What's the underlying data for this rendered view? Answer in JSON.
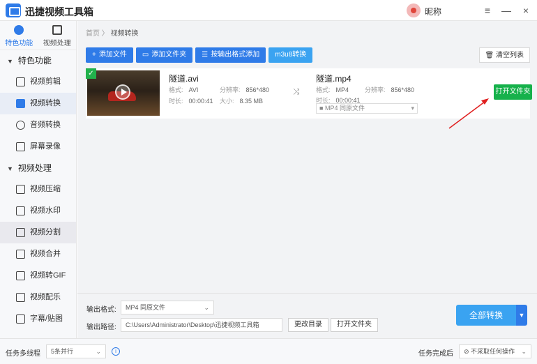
{
  "app": {
    "title": "迅捷视频工具箱",
    "user_name": "昵称"
  },
  "window": {
    "menu_icon": "≡",
    "minimize_icon": "—",
    "close_icon": "×"
  },
  "side_tabs": [
    {
      "label": "特色功能",
      "icon": "star-icon"
    },
    {
      "label": "视频处理",
      "icon": "film-icon"
    }
  ],
  "sidebar": {
    "group1": {
      "label": "特色功能",
      "items": [
        {
          "label": "视频剪辑"
        },
        {
          "label": "视频转换"
        },
        {
          "label": "音频转换"
        },
        {
          "label": "屏幕录像"
        }
      ]
    },
    "group2": {
      "label": "视频处理",
      "items": [
        {
          "label": "视频压缩"
        },
        {
          "label": "视频水印"
        },
        {
          "label": "视频分割"
        },
        {
          "label": "视频合并"
        },
        {
          "label": "视频转GIF"
        },
        {
          "label": "视频配乐"
        },
        {
          "label": "字幕/贴图"
        }
      ]
    }
  },
  "breadcrumb": {
    "home": "首页",
    "sep": "〉",
    "current": "视频转换"
  },
  "toolbar": {
    "add_file": "添加文件",
    "add_folder": "添加文件夹",
    "add_by_format": "按输出格式添加",
    "m3u8": "m3u8转换",
    "clear": "清空列表"
  },
  "file": {
    "src_name": "隧道.avi",
    "src_format_label": "格式:",
    "src_format": "AVI",
    "src_res_label": "分辨率:",
    "src_res": "856*480",
    "src_dur_label": "时长:",
    "src_dur": "00:00:41",
    "src_size_label": "大小:",
    "src_size": "8.35 MB",
    "dst_name": "隧道.mp4",
    "dst_format_label": "格式:",
    "dst_format": "MP4",
    "dst_res_label": "分辨率:",
    "dst_res": "856*480",
    "dst_dur_label": "时长:",
    "dst_dur": "00:00:41",
    "dst_select": "MP4  同原文件",
    "open_folder": "打开文件夹"
  },
  "bottom": {
    "format_label": "输出格式:",
    "format_value": "MP4  同原文件",
    "path_label": "输出路径:",
    "path_value": "C:\\Users\\Administrator\\Desktop\\迅捷视频工具箱",
    "change_dir": "更改目录",
    "open_folder": "打开文件夹",
    "convert_all": "全部转换"
  },
  "status": {
    "threads_label": "任务多线程",
    "threads_value": "5条并行",
    "after_label": "任务完成后",
    "after_value": "不采取任何操作"
  },
  "colors": {
    "accent": "#2f7be8",
    "light_accent": "#3aa3f1",
    "green": "#16b14b",
    "arrow_red": "#e02020"
  }
}
